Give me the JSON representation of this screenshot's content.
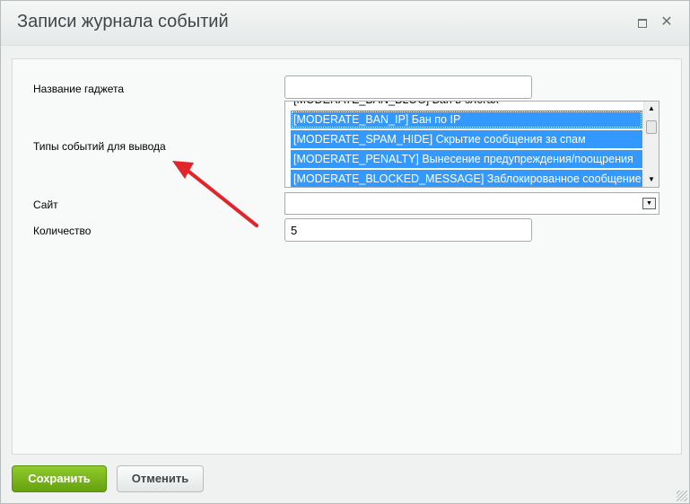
{
  "dialog": {
    "title": "Записи журнала событий",
    "maximize_icon": "maximize-icon",
    "close_icon": "close-icon",
    "close_glyph": "✕"
  },
  "form": {
    "gadget_name": {
      "label": "Название гаджета",
      "value": ""
    },
    "event_types": {
      "label": "Типы событий для вывода",
      "options": [
        {
          "text": "[MODERATE_BAN_BLOG] Бан в блогах",
          "selected": false
        },
        {
          "text": "[MODERATE_BAN_IP] Бан по IP",
          "selected": true
        },
        {
          "text": "[MODERATE_SPAM_HIDE] Скрытие сообщения за спам",
          "selected": true
        },
        {
          "text": "[MODERATE_PENALTY] Вынесение предупреждения/поощрения",
          "selected": true
        },
        {
          "text": "[MODERATE_BLOCKED_MESSAGE] Заблокированное сообщение",
          "selected": true
        }
      ]
    },
    "site": {
      "label": "Сайт",
      "value": ""
    },
    "quantity": {
      "label": "Количество",
      "value": "5"
    }
  },
  "footer": {
    "save_label": "Сохранить",
    "cancel_label": "Отменить"
  },
  "colors": {
    "selection": "#3399ff",
    "save_button": "#7bbd1c",
    "annotation_arrow": "#e0262b"
  }
}
